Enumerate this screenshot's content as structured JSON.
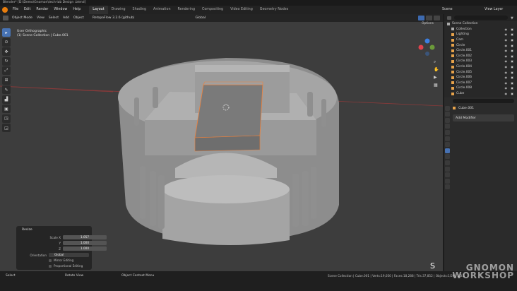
{
  "window": {
    "title": "Blender* [D:\\Demo\\Gnomon\\tech-lab Design .blend]"
  },
  "menubar": {
    "items": [
      "File",
      "Edit",
      "Render",
      "Window",
      "Help"
    ],
    "workspaces": [
      "Layout",
      "Drawing",
      "Shading",
      "Animation",
      "Rendering",
      "Compositing",
      "Video Editing",
      "Geometry Nodes"
    ],
    "active_workspace": "Layout",
    "scene_label": "Scene",
    "view_layer_label": "View Layer"
  },
  "viewport_header": {
    "mode": "Object Mode",
    "menus": [
      "View",
      "Select",
      "Add",
      "Object"
    ],
    "addon": "RetopoFlow 3.2.6 (github)",
    "orientation": "Global",
    "options": "Options"
  },
  "viewport_overlay": {
    "view_name": "User Orthographic",
    "collection_line": "(1) Scene Collection | Cube.001",
    "key_overlay": "S"
  },
  "redo_panel": {
    "title": "Resize",
    "scale_label": "Scale X",
    "y_label": "Y",
    "z_label": "Z",
    "scale_x": "1.057",
    "scale_y": "1.000",
    "scale_z": "1.000",
    "orientation_label": "Orientation",
    "orientation_value": "Global",
    "mirror_editing": "Mirror Editing",
    "proportional_editing": "Proportional Editing"
  },
  "outliner": {
    "search_placeholder": "",
    "root": "Scene Collection",
    "items": [
      "Collection",
      "Lighting",
      "Cam",
      "Circle",
      "Circle.001",
      "Circle.002",
      "Circle.003",
      "Circle.004",
      "Circle.005",
      "Circle.006",
      "Circle.007",
      "Circle.008",
      "Cube"
    ]
  },
  "properties": {
    "object_name": "Cube.001",
    "add_modifier": "Add Modifier"
  },
  "statusbar": {
    "left_select": "Select",
    "rotate_view": "Rotate View",
    "context_menu": "Object Context Menu",
    "stats": "Scene Collection | Cube.001 | Verts:19,050 | Faces:18,288 | Tris:37,852 | Objects:1/29 | 3.3.1"
  },
  "watermark": {
    "line1": "GNOMON",
    "line2": "WORKSHOP"
  },
  "colors": {
    "accent": "#4772b3",
    "selection": "#f0813a",
    "viewport_bg": "#3d3d3d"
  }
}
